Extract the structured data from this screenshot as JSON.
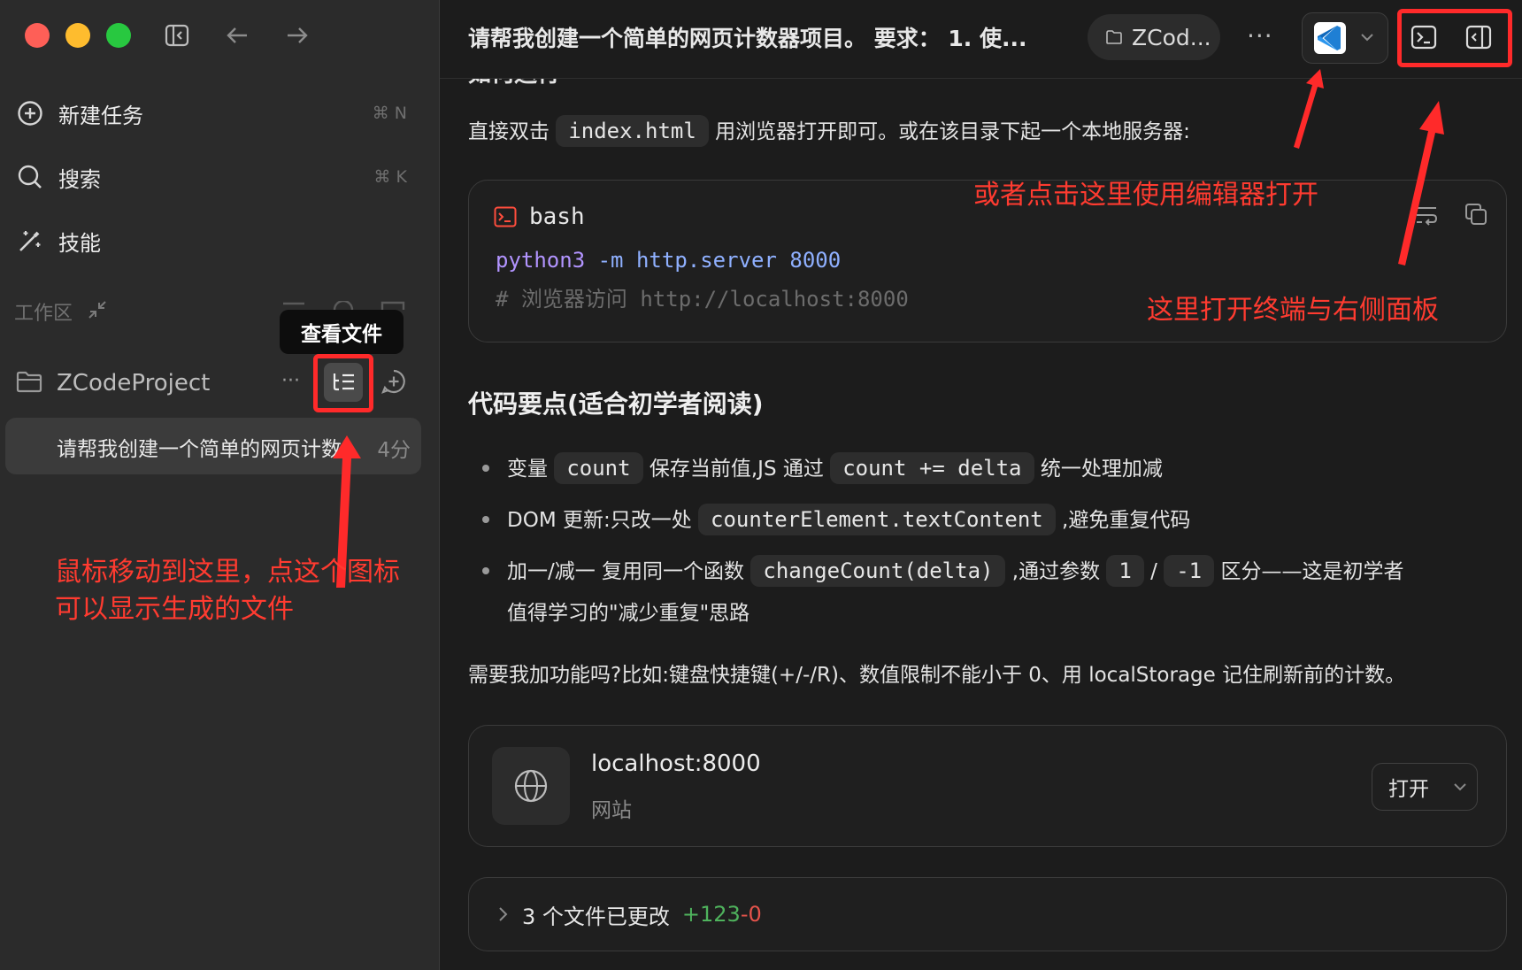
{
  "sidebar": {
    "nav": [
      {
        "label": "新建任务",
        "shortcut": "⌘ N",
        "icon": "plus-circle-icon"
      },
      {
        "label": "搜索",
        "shortcut": "⌘ K",
        "icon": "search-icon"
      },
      {
        "label": "技能",
        "icon": "magic-wand-icon"
      }
    ],
    "workspace_label": "工作区",
    "project_name": "ZCodeProject",
    "tooltip": "查看文件",
    "task": {
      "title": "请帮我创建一个简单的网页计数器项目",
      "age": "4分"
    },
    "annotation": [
      "鼠标移动到这里，点这个图标",
      "可以显示生成的文件"
    ]
  },
  "header": {
    "title": "请帮我创建一个简单的网页计数器项目。 要求： 1. 使...",
    "folder": "ZCod...",
    "more": "···"
  },
  "annotations": {
    "editor": "或者点击这里使用编辑器打开",
    "terminal": "这里打开终端与右侧面板"
  },
  "content": {
    "cut_heading": "如何运行",
    "run_line": {
      "pre": "直接双击",
      "code": "index.html",
      "post": "用浏览器打开即可。或在该目录下起一个本地服务器:"
    },
    "code_block": {
      "lang": "bash",
      "line1": {
        "cmd": "python3",
        "flag": "-m",
        "mod": "http.server",
        "port": "8000"
      },
      "line2": "# 浏览器访问 http://localhost:8000"
    },
    "section_title": "代码要点(适合初学者阅读)",
    "bullets": [
      {
        "a": "变量",
        "c1": "count",
        "b": "保存当前值,JS 通过",
        "c2": "count += delta",
        "d": "统一处理加减"
      },
      {
        "a": "DOM 更新:只改一处",
        "c1": "counterElement.textContent",
        "b": ",避免重复代码"
      },
      {
        "a": "加一/减一 复用同一个函数",
        "c1": "changeCount(delta)",
        "b": ",通过参数",
        "c2": "1",
        "sep": "/",
        "c3": "-1",
        "d": "区分——这是初学者",
        "cont": "值得学习的\"减少重复\"思路"
      }
    ],
    "question": "需要我加功能吗?比如:键盘快捷键(+/-/R)、数值限制不能小于 0、用 localStorage 记住刷新前的计数。",
    "site_card": {
      "title": "localhost:8000",
      "subtitle": "网站",
      "open_label": "打开"
    },
    "changes": {
      "label": "3 个文件已更改",
      "plus": "+123",
      "minus": "-0"
    }
  },
  "colors": {
    "accent_red": "#ff3b30",
    "added": "#4fb35d",
    "removed": "#e5534b"
  }
}
